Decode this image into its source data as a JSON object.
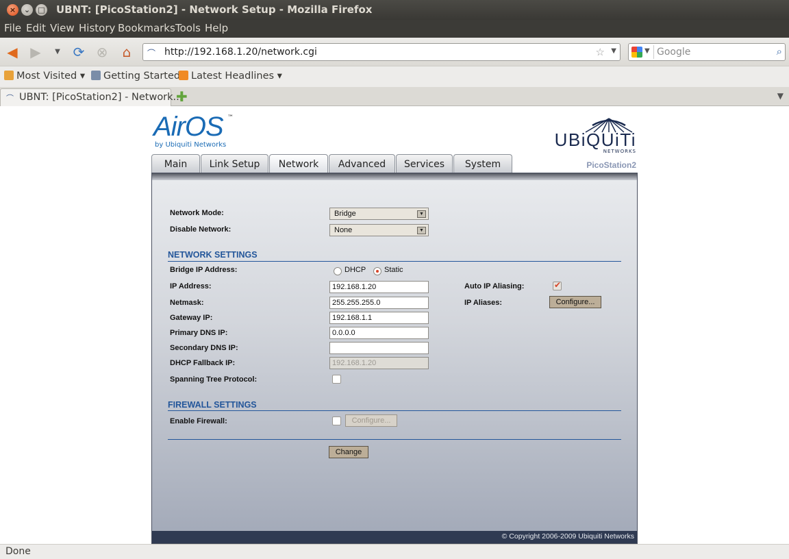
{
  "window": {
    "title": "UBNT: [PicoStation2] - Network Setup - Mozilla Firefox"
  },
  "menu": [
    "File",
    "Edit",
    "View",
    "History",
    "Bookmarks",
    "Tools",
    "Help"
  ],
  "nav": {
    "url": "http://192.168.1.20/network.cgi",
    "search_placeholder": "Google"
  },
  "bookmarks": [
    "Most Visited",
    "Getting Started",
    "Latest Headlines"
  ],
  "tab": {
    "label": "UBNT: [PicoStation2] - Network..."
  },
  "status": "Done",
  "page": {
    "logo": {
      "brand": "AirOS",
      "tm": "™",
      "byline": "by Ubiquiti Networks"
    },
    "vendor": {
      "name": "UBiQUiTi",
      "sub": "NETWORKS"
    },
    "device_name": "PicoStation2",
    "tabs": [
      "Main",
      "Link Setup",
      "Network",
      "Advanced",
      "Services",
      "System"
    ],
    "active_tab": "Network",
    "form": {
      "network_mode_label": "Network Mode:",
      "network_mode_value": "Bridge",
      "disable_network_label": "Disable Network:",
      "disable_network_value": "None",
      "network_settings_heading": "NETWORK SETTINGS",
      "bridge_ip_label": "Bridge IP Address:",
      "dhcp_label": "DHCP",
      "static_label": "Static",
      "ip_address_label": "IP Address:",
      "ip_address_value": "192.168.1.20",
      "netmask_label": "Netmask:",
      "netmask_value": "255.255.255.0",
      "gateway_label": "Gateway IP:",
      "gateway_value": "192.168.1.1",
      "primary_dns_label": "Primary DNS IP:",
      "primary_dns_value": "0.0.0.0",
      "secondary_dns_label": "Secondary DNS IP:",
      "secondary_dns_value": "",
      "dhcp_fallback_label": "DHCP Fallback IP:",
      "dhcp_fallback_value": "192.168.1.20",
      "stp_label": "Spanning Tree Protocol:",
      "auto_ip_aliasing_label": "Auto IP Aliasing:",
      "ip_aliases_label": "IP Aliases:",
      "configure_label": "Configure...",
      "firewall_heading": "FIREWALL SETTINGS",
      "enable_firewall_label": "Enable Firewall:",
      "firewall_configure_label": "Configure...",
      "change_label": "Change"
    },
    "copyright": "© Copyright 2006-2009 Ubiquiti Networks"
  }
}
